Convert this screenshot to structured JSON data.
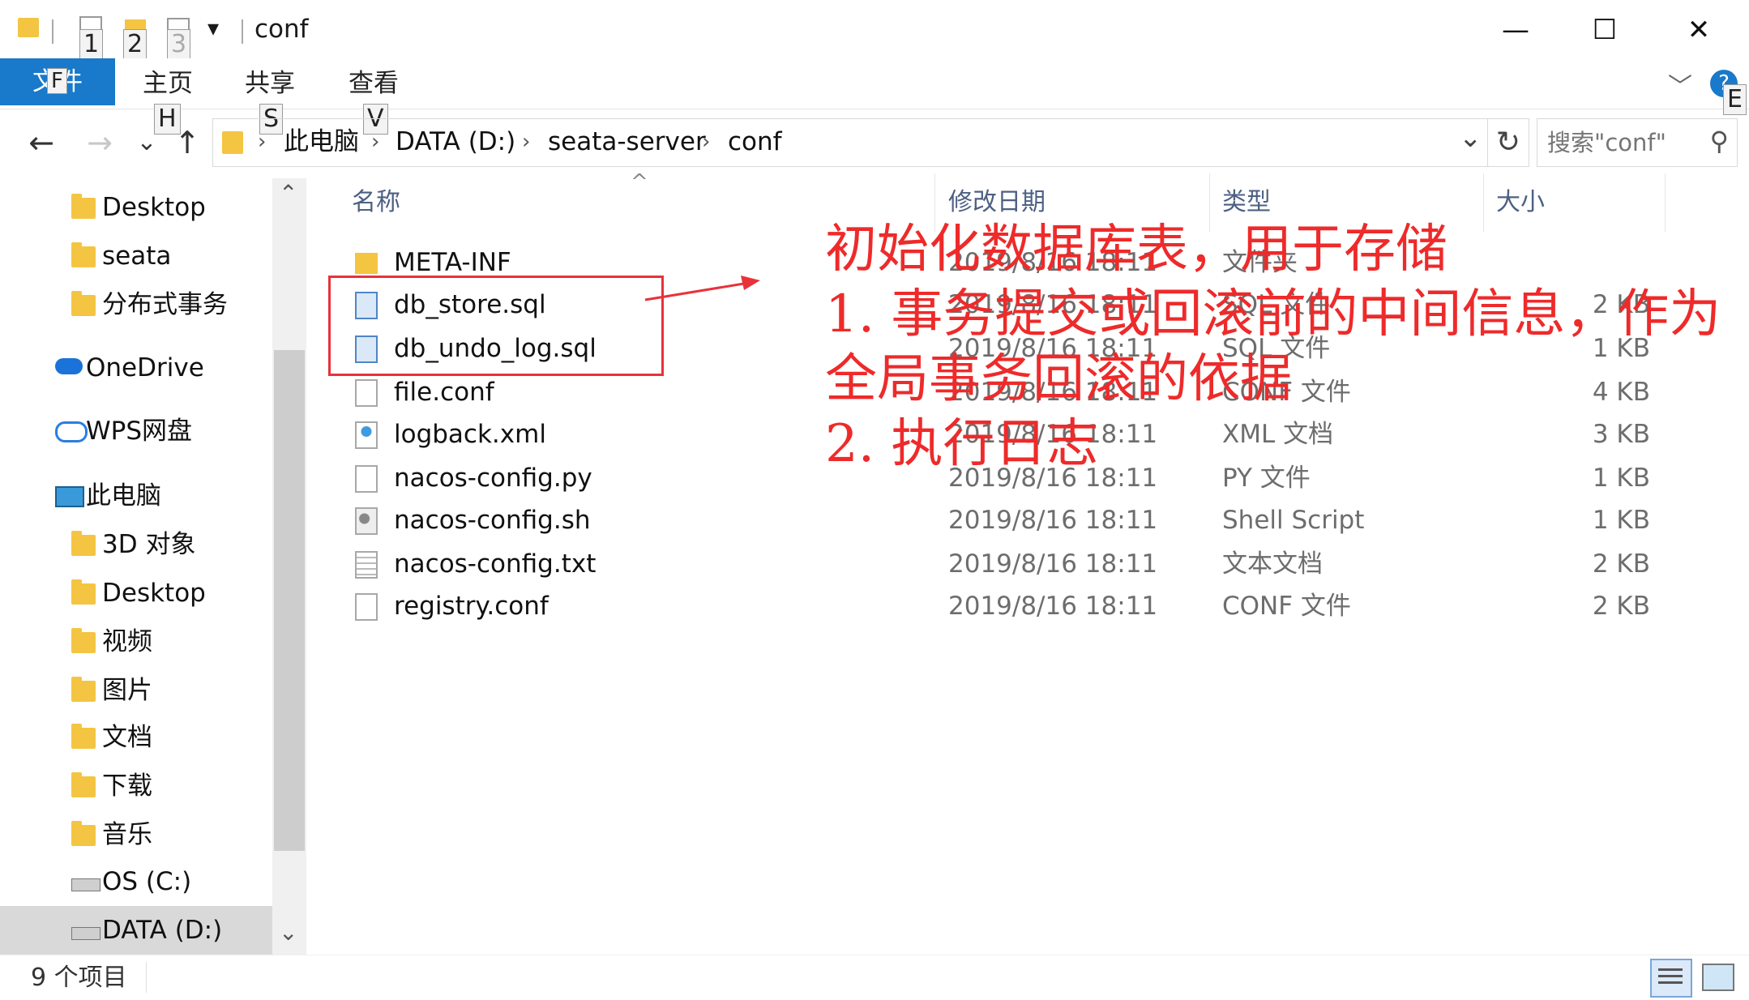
{
  "window": {
    "title": "conf",
    "controls": {
      "minimize": "—",
      "maximize": "☐",
      "close": "✕"
    },
    "help": "?"
  },
  "quick_access": {
    "keytips": [
      "1",
      "2",
      "3"
    ],
    "dropdown": "▾"
  },
  "ribbon": {
    "file_tab": "文件",
    "file_keytip": "F",
    "tabs": [
      {
        "label": "主页",
        "keytip": "H"
      },
      {
        "label": "共享",
        "keytip": "S"
      },
      {
        "label": "查看",
        "keytip": "V"
      }
    ],
    "expand": "﹀",
    "help_keytip": "E"
  },
  "navigation": {
    "back": "←",
    "forward": "→",
    "recent": "⌄",
    "up": "↑",
    "breadcrumbs": [
      "此电脑",
      "DATA (D:)",
      "seata-server",
      "conf"
    ],
    "separator": "›",
    "address_dropdown": "⌄",
    "refresh": "↻",
    "search_placeholder": "搜索\"conf\""
  },
  "sidebar": {
    "items": [
      {
        "label": "Desktop",
        "icon": "desktop-folder-icon"
      },
      {
        "label": "seata",
        "icon": "folder-icon"
      },
      {
        "label": "分布式事务",
        "icon": "folder-icon"
      },
      {
        "label": "OneDrive",
        "icon": "onedrive-cloud-icon"
      },
      {
        "label": "WPS网盘",
        "icon": "wps-cloud-icon"
      },
      {
        "label": "此电脑",
        "icon": "computer-icon"
      },
      {
        "label": "3D 对象",
        "icon": "3d-objects-icon"
      },
      {
        "label": "Desktop",
        "icon": "desktop-folder-icon"
      },
      {
        "label": "视频",
        "icon": "videos-folder-icon"
      },
      {
        "label": "图片",
        "icon": "pictures-folder-icon"
      },
      {
        "label": "文档",
        "icon": "documents-folder-icon"
      },
      {
        "label": "下载",
        "icon": "downloads-folder-icon"
      },
      {
        "label": "音乐",
        "icon": "music-folder-icon"
      },
      {
        "label": "OS (C:)",
        "icon": "os-drive-icon"
      },
      {
        "label": "DATA (D:)",
        "icon": "drive-icon"
      }
    ]
  },
  "file_list": {
    "sort_indicator": "^",
    "columns": {
      "name": "名称",
      "date": "修改日期",
      "type": "类型",
      "size": "大小"
    },
    "rows": [
      {
        "name": "META-INF",
        "date": "2019/8/16 18:11",
        "type": "文件夹",
        "size": "",
        "icon": "folder-icon"
      },
      {
        "name": "db_store.sql",
        "date": "2019/8/16 18:11",
        "type": "SQL 文件",
        "size": "2 KB",
        "icon": "sql-file-icon"
      },
      {
        "name": "db_undo_log.sql",
        "date": "2019/8/16 18:11",
        "type": "SQL 文件",
        "size": "1 KB",
        "icon": "sql-file-icon"
      },
      {
        "name": "file.conf",
        "date": "2019/8/16 18:11",
        "type": "CONF 文件",
        "size": "4 KB",
        "icon": "blank-file-icon"
      },
      {
        "name": "logback.xml",
        "date": "2019/8/16 18:11",
        "type": "XML 文档",
        "size": "3 KB",
        "icon": "xml-file-icon"
      },
      {
        "name": "nacos-config.py",
        "date": "2019/8/16 18:11",
        "type": "PY 文件",
        "size": "1 KB",
        "icon": "blank-file-icon"
      },
      {
        "name": "nacos-config.sh",
        "date": "2019/8/16 18:11",
        "type": "Shell Script",
        "size": "1 KB",
        "icon": "shell-file-icon"
      },
      {
        "name": "nacos-config.txt",
        "date": "2019/8/16 18:11",
        "type": "文本文档",
        "size": "2 KB",
        "icon": "text-file-icon"
      },
      {
        "name": "registry.conf",
        "date": "2019/8/16 18:11",
        "type": "CONF 文件",
        "size": "2 KB",
        "icon": "blank-file-icon"
      }
    ]
  },
  "status": {
    "count": "9 个项目"
  },
  "annotation": {
    "color": "#ee2a2a",
    "lines": [
      "初始化数据库表，用于存储",
      "1. 事务提交或回滚前的中间信息，作为",
      "全局事务回滚的依据",
      "2. 执行日志"
    ]
  },
  "colors": {
    "file_tab": "#1979ca",
    "header_text": "#4d6082",
    "annotation_red": "#ee2a2a"
  }
}
